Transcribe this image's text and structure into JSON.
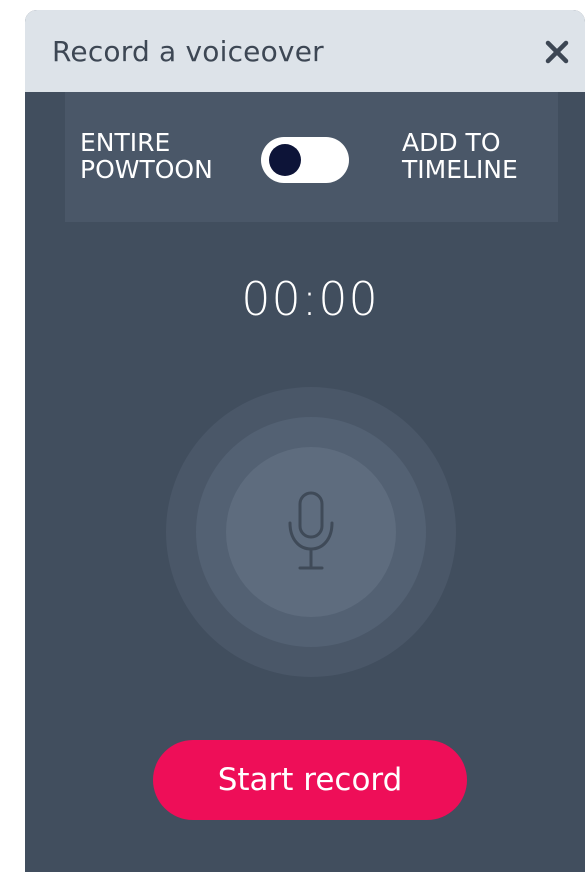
{
  "dialog": {
    "title": "Record a voiceover",
    "close_icon": "close-icon"
  },
  "mode": {
    "left_label_line1": "ENTIRE",
    "left_label_line2": "POWTOON",
    "right_label_line1": "ADD TO",
    "right_label_line2": "TIMELINE",
    "toggle_state": "left"
  },
  "timer": {
    "value": "00:00"
  },
  "mic": {
    "icon": "microphone-icon"
  },
  "actions": {
    "start_label": "Start record"
  },
  "colors": {
    "header_bg": "#dde3e9",
    "body_bg": "#414e5e",
    "accent": "#ee0e58",
    "toggle_knob": "#0d1438"
  }
}
